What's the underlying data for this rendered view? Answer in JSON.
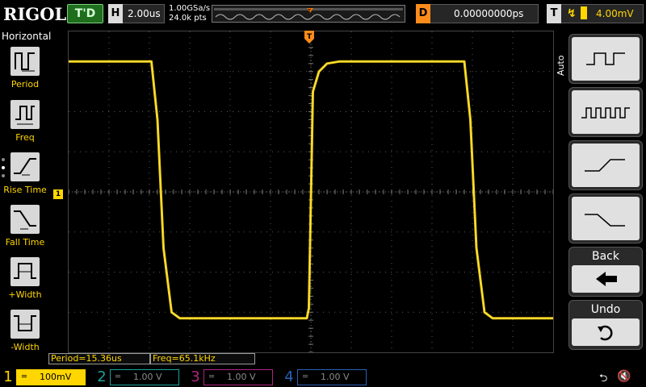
{
  "brand": "RIGOL",
  "status": {
    "trigger_state": "T'D"
  },
  "horizontal": {
    "key": "H",
    "timebase": "2.00us",
    "sample_rate": "1.00GSa/s",
    "memory_depth": "24.0k pts"
  },
  "delay": {
    "key": "D",
    "value": "0.00000000ps"
  },
  "trigger": {
    "key": "T",
    "level": "4.00mV",
    "source_color": "#ffd600"
  },
  "left_menu": {
    "title": "Horizontal",
    "items": [
      {
        "label": "Period",
        "icon": "period-icon"
      },
      {
        "label": "Freq",
        "icon": "freq-icon"
      },
      {
        "label": "Rise Time",
        "icon": "rise-time-icon"
      },
      {
        "label": "Fall Time",
        "icon": "fall-time-icon"
      },
      {
        "label": "+Width",
        "icon": "positive-width-icon"
      },
      {
        "label": "-Width",
        "icon": "negative-width-icon"
      }
    ]
  },
  "right_menu": {
    "mode": "Auto",
    "buttons": [
      {
        "icon": "single-pulse-icon"
      },
      {
        "icon": "multi-pulse-icon"
      },
      {
        "icon": "rising-edge-icon"
      },
      {
        "icon": "falling-edge-icon"
      },
      {
        "label": "Back",
        "icon": "back-arrow-icon"
      },
      {
        "label": "Undo",
        "icon": "undo-icon"
      }
    ]
  },
  "measurements": [
    {
      "text": "Period=15.36us"
    },
    {
      "text": "Freq=65.1kHz"
    }
  ],
  "channels": [
    {
      "num": "1",
      "coupling": "═",
      "scale": "100mV",
      "color": "#ffd600",
      "active": true
    },
    {
      "num": "2",
      "coupling": "═",
      "scale": "1.00 V",
      "color": "#1aa39a",
      "active": false
    },
    {
      "num": "3",
      "coupling": "═",
      "scale": "1.00 V",
      "color": "#b0237f",
      "active": false
    },
    {
      "num": "4",
      "coupling": "═",
      "scale": "1.00 V",
      "color": "#2a5fb8",
      "active": false
    }
  ],
  "markers": {
    "ch1": "1",
    "trig_top": "T"
  },
  "chart_data": {
    "type": "line",
    "x_unit": "us",
    "x_divisions": 12,
    "y_divisions": 8,
    "trace_color": "#ffd600",
    "series": [
      {
        "x": [
          -12.0,
          -7.9,
          -7.6,
          -7.3,
          -6.9,
          -6.5,
          -0.2,
          -0.1,
          0.1,
          0.4,
          0.8,
          1.4,
          7.6,
          7.9,
          8.2,
          8.6,
          9.0,
          12.0
        ],
        "y": [
          3.25,
          3.25,
          1.8,
          -1.4,
          -3.0,
          -3.15,
          -3.15,
          -2.9,
          2.5,
          3.0,
          3.2,
          3.25,
          3.25,
          1.8,
          -1.4,
          -3.0,
          -3.15,
          -3.15
        ]
      }
    ]
  }
}
